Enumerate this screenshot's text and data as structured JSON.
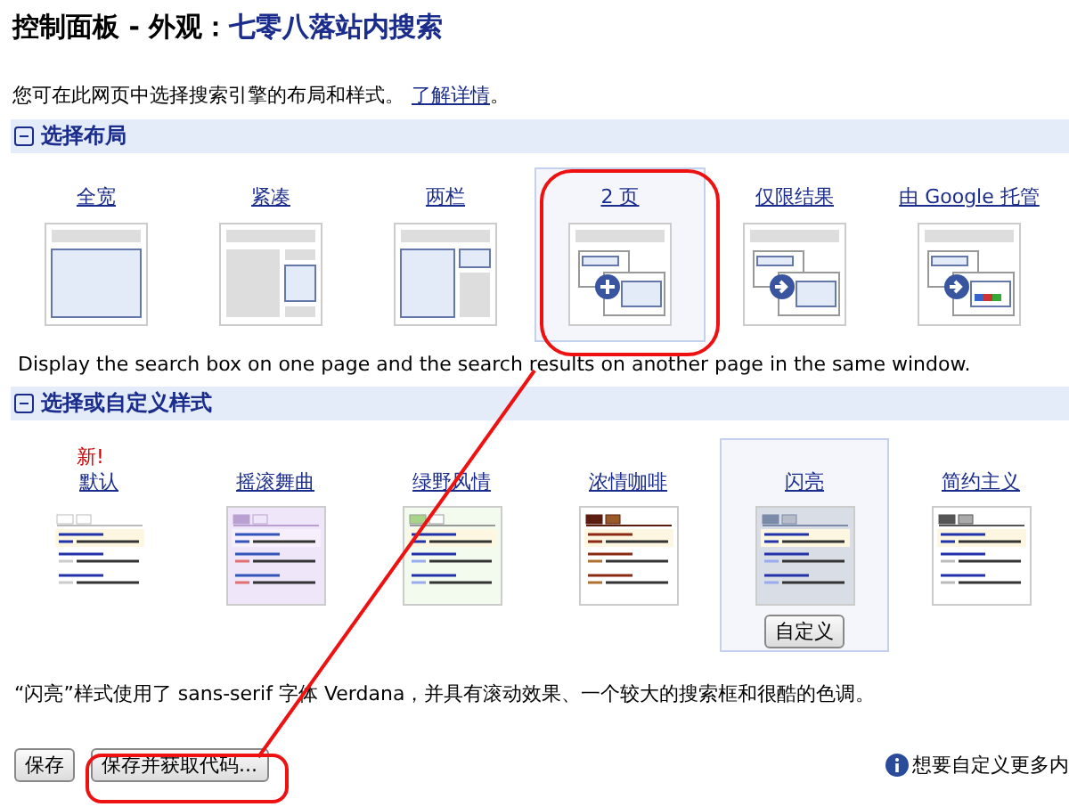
{
  "title": {
    "prefix": "控制面板 - 外观：",
    "name": "七零八落站内搜索"
  },
  "intro": {
    "text": "您可在此网页中选择搜索引擎的布局和样式。",
    "link": "了解详情",
    "suffix": "。"
  },
  "layout_section": {
    "header": "选择布局",
    "expanded": true,
    "layouts": [
      {
        "label": "全宽",
        "kind": "full",
        "selected": false
      },
      {
        "label": "紧凑",
        "kind": "compact",
        "selected": false
      },
      {
        "label": "两栏",
        "kind": "two-column",
        "selected": false
      },
      {
        "label": "2 页",
        "kind": "two-page",
        "selected": true
      },
      {
        "label": "仅限结果",
        "kind": "results-only",
        "selected": false
      },
      {
        "label": "由 Google 托管",
        "kind": "hosted",
        "selected": false
      }
    ],
    "description": "Display the search box on one page and the search results on another page in the same window."
  },
  "style_section": {
    "header": "选择或自定义样式",
    "expanded": true,
    "styles": [
      {
        "label": "默认",
        "kind": "default",
        "badge": "新!",
        "selected": false
      },
      {
        "label": "摇滚舞曲",
        "kind": "rock",
        "selected": false
      },
      {
        "label": "绿野风情",
        "kind": "green",
        "selected": false
      },
      {
        "label": "浓情咖啡",
        "kind": "coffee",
        "selected": false
      },
      {
        "label": "闪亮",
        "kind": "shiny",
        "selected": true
      },
      {
        "label": "简约主义",
        "kind": "minimalist",
        "selected": false
      }
    ],
    "customize_button": "自定义",
    "description": "“闪亮”样式使用了 sans-serif 字体 Verdana，并具有滚动效果、一个较大的搜索框和很酷的色调。"
  },
  "footer": {
    "buttons": [
      "保存",
      "保存并获取代码..."
    ],
    "help": "想要自定义更多内"
  }
}
